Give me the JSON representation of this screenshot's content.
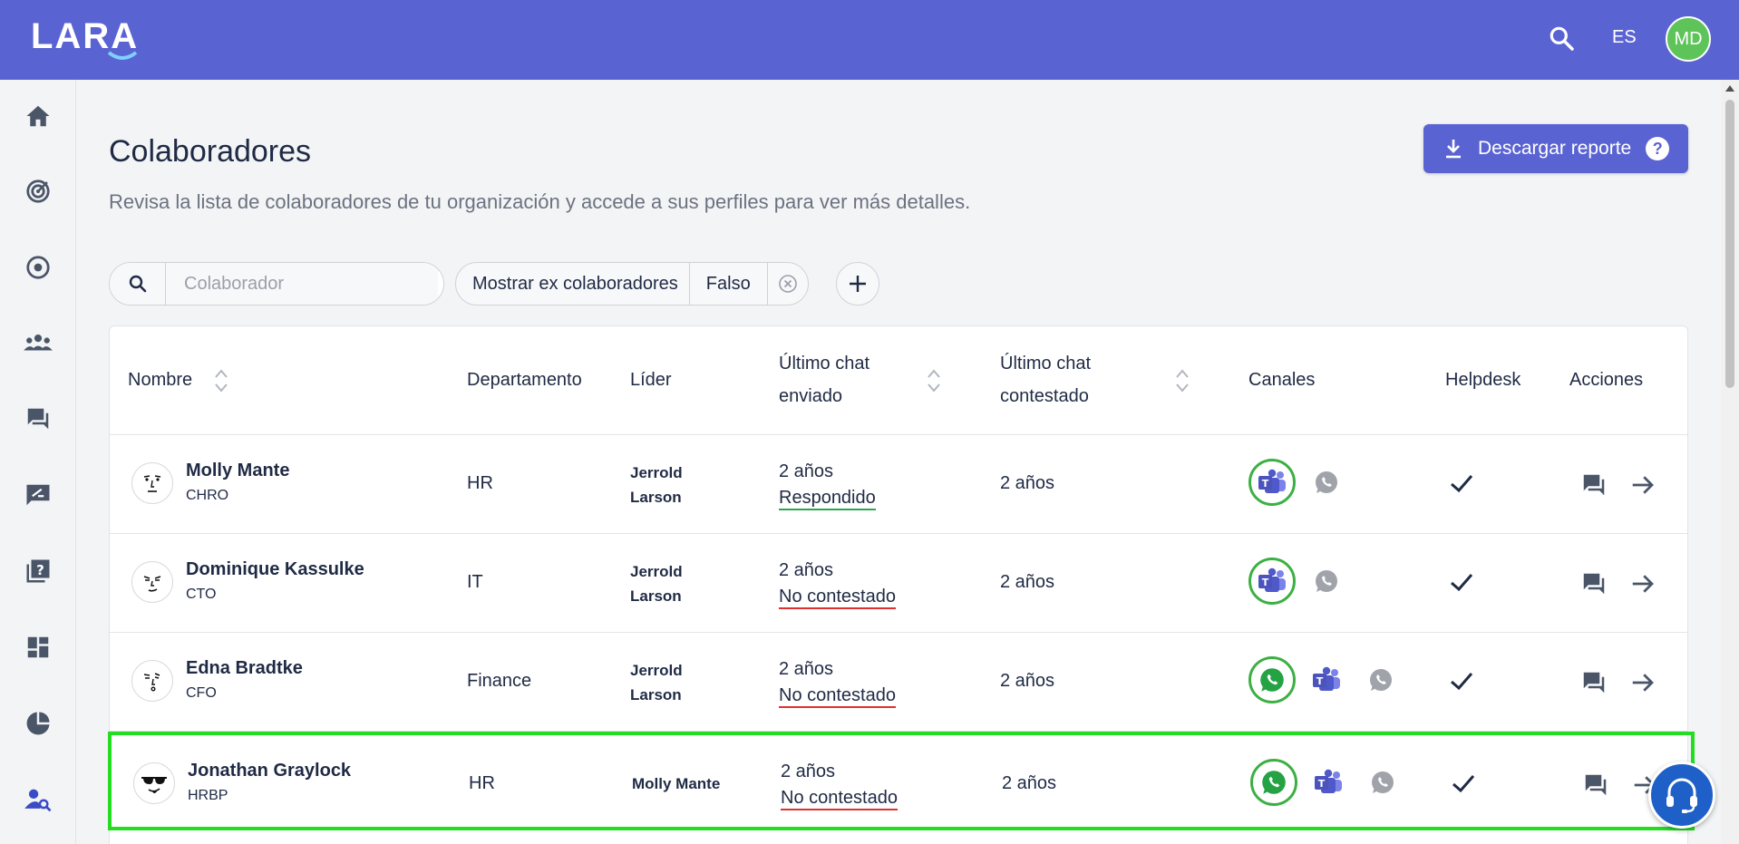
{
  "header": {
    "logo": "LARA",
    "language": "ES",
    "user_initials": "MD"
  },
  "page": {
    "title": "Colaboradores",
    "subtitle": "Revisa la lista de colaboradores de tu organización y accede a sus perfiles para ver más detalles.",
    "download_label": "Descargar reporte",
    "help_glyph": "?"
  },
  "search": {
    "placeholder": "Colaborador"
  },
  "filter": {
    "key": "Mostrar ex colaboradores",
    "value": "Falso"
  },
  "table": {
    "columns": {
      "name": "Nombre",
      "department": "Departamento",
      "leader": "Líder",
      "last_sent_1": "Último chat",
      "last_sent_2": "enviado",
      "last_answered_1": "Último chat",
      "last_answered_2": "contestado",
      "channels": "Canales",
      "helpdesk": "Helpdesk",
      "actions": "Acciones"
    },
    "rows": [
      {
        "name": "Molly Mante",
        "role": "CHRO",
        "department": "HR",
        "leader_1": "Jerrold",
        "leader_2": "Larson",
        "last_sent": "2 años",
        "status": "Respondido",
        "last_answered": "2 años",
        "channels": [
          "teams-icon",
          "whatsapp-icon"
        ],
        "active_channel": "teams-icon"
      },
      {
        "name": "Dominique Kassulke",
        "role": "CTO",
        "department": "IT",
        "leader_1": "Jerrold",
        "leader_2": "Larson",
        "last_sent": "2 años",
        "status": "No contestado",
        "last_answered": "2 años",
        "channels": [
          "teams-icon",
          "whatsapp-icon"
        ],
        "active_channel": "teams-icon"
      },
      {
        "name": "Edna Bradtke",
        "role": "CFO",
        "department": "Finance",
        "leader_1": "Jerrold",
        "leader_2": "Larson",
        "last_sent": "2 años",
        "status": "No contestado",
        "last_answered": "2 años",
        "channels": [
          "whatsapp-icon",
          "teams-icon",
          "whatsapp-icon"
        ],
        "active_channel": "whatsapp-icon"
      },
      {
        "name": "Jonathan Graylock",
        "role": "HRBP",
        "department": "HR",
        "leader_1": "Molly Mante",
        "leader_2": "",
        "last_sent": "2 años",
        "status": "No contestado",
        "last_answered": "2 años",
        "channels": [
          "whatsapp-icon",
          "teams-icon",
          "whatsapp-icon"
        ],
        "active_channel": "whatsapp-icon"
      }
    ]
  },
  "sidebar": {
    "items": [
      "home-icon",
      "target-icon",
      "radio-icon",
      "team-icon",
      "chat-icon",
      "feedback-icon",
      "quiz-icon",
      "dashboard-icon",
      "pie-chart-icon",
      "user-search-icon"
    ]
  },
  "colors": {
    "brand": "#5a63d2",
    "success": "#2ea44f",
    "error": "#e03131",
    "highlight": "#22dd22"
  }
}
